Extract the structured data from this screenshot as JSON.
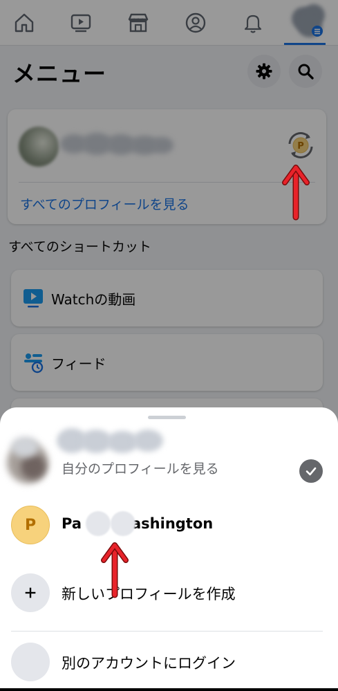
{
  "nav": {
    "items": [
      {
        "name": "home",
        "icon": "home-icon"
      },
      {
        "name": "watch",
        "icon": "video-play-icon"
      },
      {
        "name": "marketplace",
        "icon": "store-icon"
      },
      {
        "name": "profile",
        "icon": "person-circle-icon"
      },
      {
        "name": "notifications",
        "icon": "bell-icon"
      },
      {
        "name": "menu",
        "icon": "menu-icon",
        "active": true
      }
    ],
    "accent": "#1b74e4"
  },
  "header": {
    "title": "メニュー",
    "settings_icon": "gear-icon",
    "search_icon": "search-icon"
  },
  "profile_card": {
    "see_all_profiles": "すべてのプロフィールを見る",
    "switch_badge_letter": "P"
  },
  "shortcuts": {
    "label": "すべてのショートカット",
    "items": [
      {
        "label": "Watchの動画",
        "icon": "watch-video-icon"
      },
      {
        "label": "フィード",
        "icon": "feed-icon"
      }
    ]
  },
  "sheet": {
    "current_profile_subtitle": "自分のプロフィールを見る",
    "page_profile": {
      "letter": "P",
      "name_start": "Pa",
      "name_end": "ashington"
    },
    "create_profile": "新しいプロフィールを作成",
    "login_other": "別のアカウントにログイン"
  },
  "annotation_color": "#e8232a"
}
